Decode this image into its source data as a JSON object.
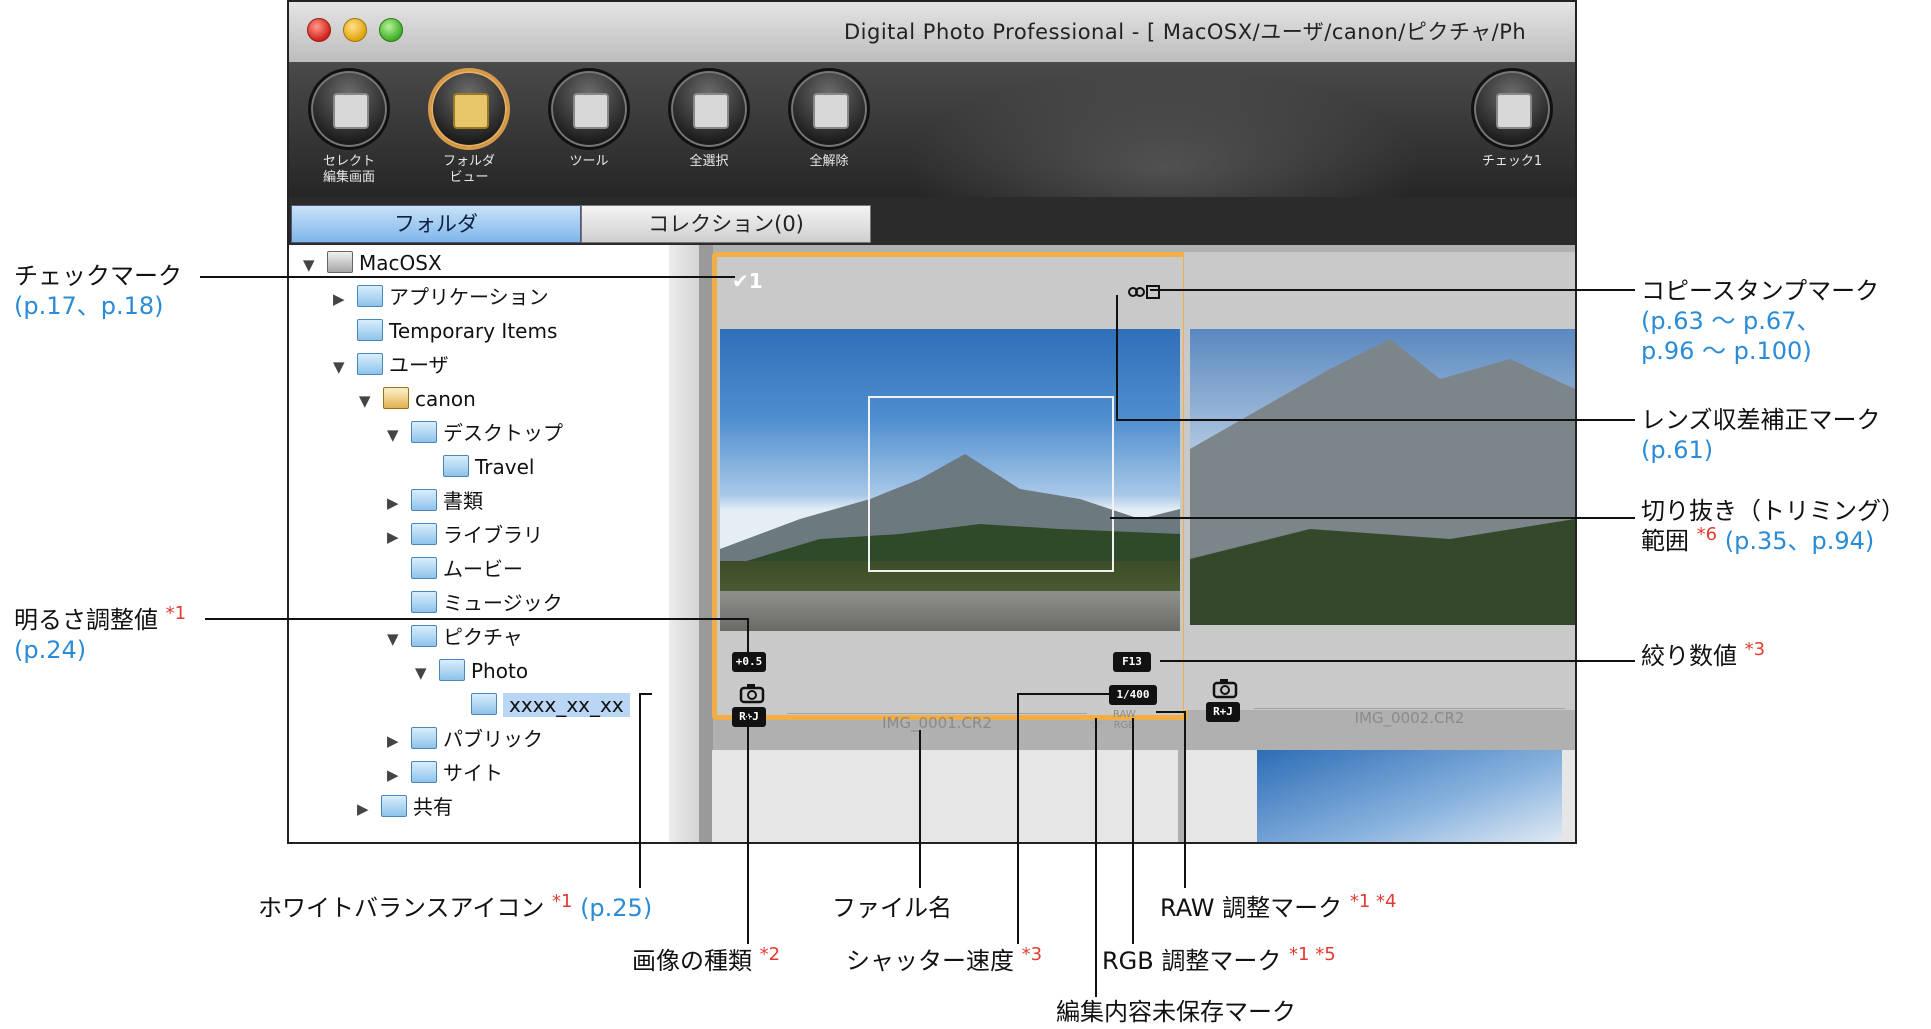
{
  "window": {
    "title": "Digital Photo Professional - [ MacOSX/ユーザ/canon/ピクチャ/Ph"
  },
  "toolbar": {
    "buttons": [
      {
        "label": "セレクト\n編集画面",
        "icon": "edit-icon"
      },
      {
        "label": "フォルダ\nビュー",
        "icon": "folder-view-icon",
        "selected": true
      },
      {
        "label": "ツール",
        "icon": "tool-icon"
      },
      {
        "label": "全選択",
        "icon": "select-all-icon"
      },
      {
        "label": "全解除",
        "icon": "deselect-all-icon"
      },
      {
        "label": "チェック1",
        "icon": "check-mark-icon"
      }
    ]
  },
  "tabs": {
    "folder": "フォルダ",
    "collection": "コレクション(0)"
  },
  "tree": {
    "nodes": [
      {
        "label": "MacOSX",
        "expanded": true,
        "type": "drive"
      },
      {
        "label": "アプリケーション",
        "expanded": false
      },
      {
        "label": "Temporary Items"
      },
      {
        "label": "ユーザ",
        "expanded": true
      },
      {
        "label": "canon",
        "expanded": true,
        "type": "home"
      },
      {
        "label": "デスクトップ",
        "expanded": true
      },
      {
        "label": "Travel"
      },
      {
        "label": "書類",
        "expanded": false
      },
      {
        "label": "ライブラリ",
        "expanded": false
      },
      {
        "label": "ムービー"
      },
      {
        "label": "ミュージック"
      },
      {
        "label": "ピクチャ",
        "expanded": true
      },
      {
        "label": "Photo",
        "expanded": true
      },
      {
        "label": "xxxx_xx_xx",
        "selected": true
      },
      {
        "label": "パブリック",
        "expanded": false
      },
      {
        "label": "サイト",
        "expanded": false
      },
      {
        "label": "共有",
        "expanded": false
      }
    ]
  },
  "thumbnails": [
    {
      "filename": "IMG_0001.CR2",
      "brightness": "+0.5",
      "aperture": "F13",
      "shutter": "1/400",
      "image_type": "R+J",
      "raw_mark": "RAW",
      "rgb_mark": "RGB",
      "unsaved_mark": "☆",
      "check_mark": "✔1",
      "selected": true
    },
    {
      "filename": "IMG_0002.CR2",
      "image_type": "R+J"
    }
  ],
  "annotations": {
    "check_mark": {
      "text": "チェックマーク",
      "ref": "(p.17、p.18)"
    },
    "brightness": {
      "text": "明るさ調整値",
      "star": "*1",
      "ref": "(p.24)"
    },
    "white_balance": {
      "text": "ホワイトバランスアイコン",
      "star": "*1",
      "ref": "(p.25)"
    },
    "image_type": {
      "text": "画像の種類",
      "star": "*2"
    },
    "file_name": {
      "text": "ファイル名"
    },
    "shutter": {
      "text": "シャッター速度",
      "star": "*3"
    },
    "unsaved": {
      "text": "編集内容未保存マーク"
    },
    "rgb": {
      "text": "RGB 調整マーク",
      "star": "*1 *5"
    },
    "raw": {
      "text": "RAW 調整マーク",
      "star": "*1 *4"
    },
    "copy_stamp": {
      "text": "コピースタンプマーク",
      "ref1": "(p.63 ～ p.67、",
      "ref2": "p.96 ～ p.100)"
    },
    "lens": {
      "text": "レンズ収差補正マーク",
      "ref": "(p.61)"
    },
    "crop": {
      "text1": "切り抜き（トリミング）",
      "text2": "範囲",
      "star": "*6",
      "ref": "(p.35、p.94)"
    },
    "aperture": {
      "text": "絞り数値",
      "star": "*3"
    }
  }
}
